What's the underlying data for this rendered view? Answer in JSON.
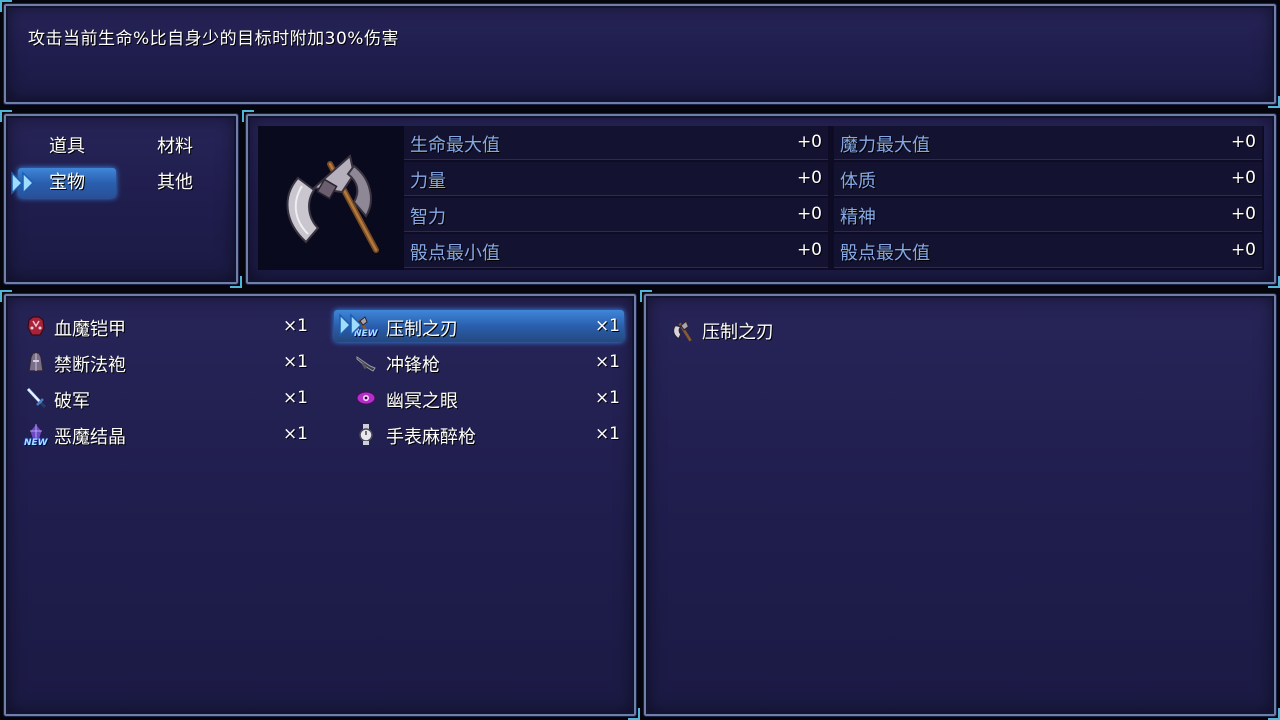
{
  "help": {
    "description": "攻击当前生命%比自身少的目标时附加30%伤害"
  },
  "categories": [
    {
      "label": "道具",
      "selected": false
    },
    {
      "label": "材料",
      "selected": false
    },
    {
      "label": "宝物",
      "selected": true
    },
    {
      "label": "其他",
      "selected": false
    }
  ],
  "status": {
    "item_icon": "battle-axe-icon",
    "stats": [
      {
        "name": "生命最大值",
        "value": "+0"
      },
      {
        "name": "魔力最大值",
        "value": "+0"
      },
      {
        "name": "力量",
        "value": "+0"
      },
      {
        "name": "体质",
        "value": "+0"
      },
      {
        "name": "智力",
        "value": "+0"
      },
      {
        "name": "精神",
        "value": "+0"
      },
      {
        "name": "骰点最小值",
        "value": "+0"
      },
      {
        "name": "骰点最大值",
        "value": "+0"
      }
    ]
  },
  "items": [
    {
      "name": "血魔铠甲",
      "qty": "×1",
      "icon": "armor-icon",
      "new": false,
      "selected": false
    },
    {
      "name": "压制之刃",
      "qty": "×1",
      "icon": "axe-icon",
      "new": true,
      "selected": true
    },
    {
      "name": "禁断法袍",
      "qty": "×1",
      "icon": "robe-icon",
      "new": false,
      "selected": false
    },
    {
      "name": "冲锋枪",
      "qty": "×1",
      "icon": "gun-icon",
      "new": false,
      "selected": false
    },
    {
      "name": "破军",
      "qty": "×1",
      "icon": "sword-icon",
      "new": false,
      "selected": false
    },
    {
      "name": "幽冥之眼",
      "qty": "×1",
      "icon": "eye-icon",
      "new": false,
      "selected": false
    },
    {
      "name": "恶魔结晶",
      "qty": "×1",
      "icon": "crystal-icon",
      "new": true,
      "selected": false
    },
    {
      "name": "手表麻醉枪",
      "qty": "×1",
      "icon": "watch-icon",
      "new": false,
      "selected": false
    }
  ],
  "new_badge": "NEW",
  "detail": {
    "name": "压制之刃",
    "icon": "axe-icon"
  },
  "colors": {
    "window_bg": "#1f1d4c",
    "stat_label": "#86a9e6",
    "selection": "#2a5fae"
  }
}
